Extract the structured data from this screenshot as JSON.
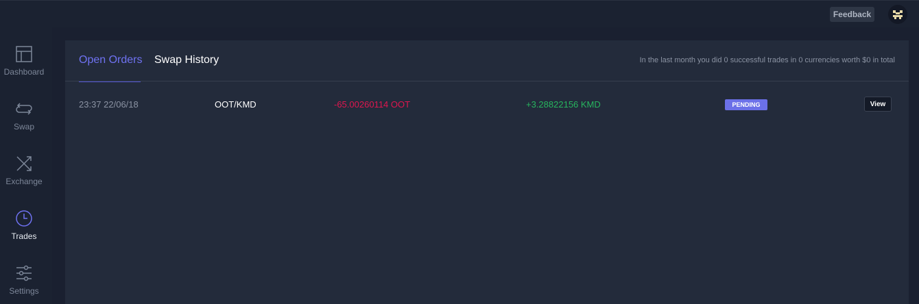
{
  "header": {
    "feedback_label": "Feedback"
  },
  "sidebar": {
    "items": [
      {
        "label": "Dashboard",
        "icon": "dashboard-icon"
      },
      {
        "label": "Swap",
        "icon": "swap-icon"
      },
      {
        "label": "Exchange",
        "icon": "exchange-icon"
      },
      {
        "label": "Trades",
        "icon": "clock-icon",
        "active": true
      },
      {
        "label": "Settings",
        "icon": "sliders-icon"
      }
    ]
  },
  "main": {
    "tabs": [
      {
        "label": "Open Orders",
        "active": true
      },
      {
        "label": "Swap History"
      }
    ],
    "stats_text": "In the last month you did 0 successful trades in 0 currencies worth $0 in total",
    "orders": [
      {
        "time": "23:37 22/06/18",
        "pair": "OOT/KMD",
        "sent": "-65.00260114 OOT",
        "received": "+3.28822156 KMD",
        "status": "PENDING",
        "action": "View"
      }
    ]
  },
  "colors": {
    "accent": "#6f72f2",
    "negative": "#e0164f",
    "positive": "#27b55e",
    "badge": "#6b70e8"
  }
}
